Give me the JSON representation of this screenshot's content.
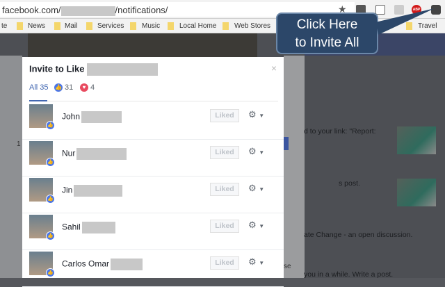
{
  "browser": {
    "url_prefix": "facebook.com/",
    "url_suffix": "/notifications/",
    "star_icon": "★",
    "bookmarks": [
      {
        "label": "te"
      },
      {
        "label": "News"
      },
      {
        "label": "Mail"
      },
      {
        "label": "Services"
      },
      {
        "label": "Music"
      },
      {
        "label": "Local Home"
      },
      {
        "label": "Web Stores"
      },
      {
        "label": "Travel"
      }
    ],
    "extensions": {
      "abp": "ABP"
    }
  },
  "callout": {
    "line1": "Click Here",
    "line2": "to Invite All"
  },
  "background": {
    "notifications": [
      "d to your link: \"Report:",
      "s post.",
      "ate Change - an open discussion.",
      "you in a while. Write a post."
    ],
    "close_fragment": "se",
    "side_number": "1"
  },
  "modal": {
    "title": "Invite to Like",
    "close": "×",
    "tabs": [
      {
        "label": "All 35"
      },
      {
        "label": "31",
        "icon": "like"
      },
      {
        "label": "4",
        "icon": "love"
      }
    ],
    "people": [
      {
        "name": "John",
        "button": "Liked"
      },
      {
        "name": "Nur",
        "button": "Liked"
      },
      {
        "name": "Jin",
        "button": "Liked"
      },
      {
        "name": "Sahil",
        "button": "Liked"
      },
      {
        "name": "Carlos Omar",
        "button": "Liked"
      }
    ]
  },
  "colors": {
    "accent": "#4267b2",
    "like": "#4a76e8",
    "love": "#e84a5f",
    "callout": "#2c4769"
  }
}
